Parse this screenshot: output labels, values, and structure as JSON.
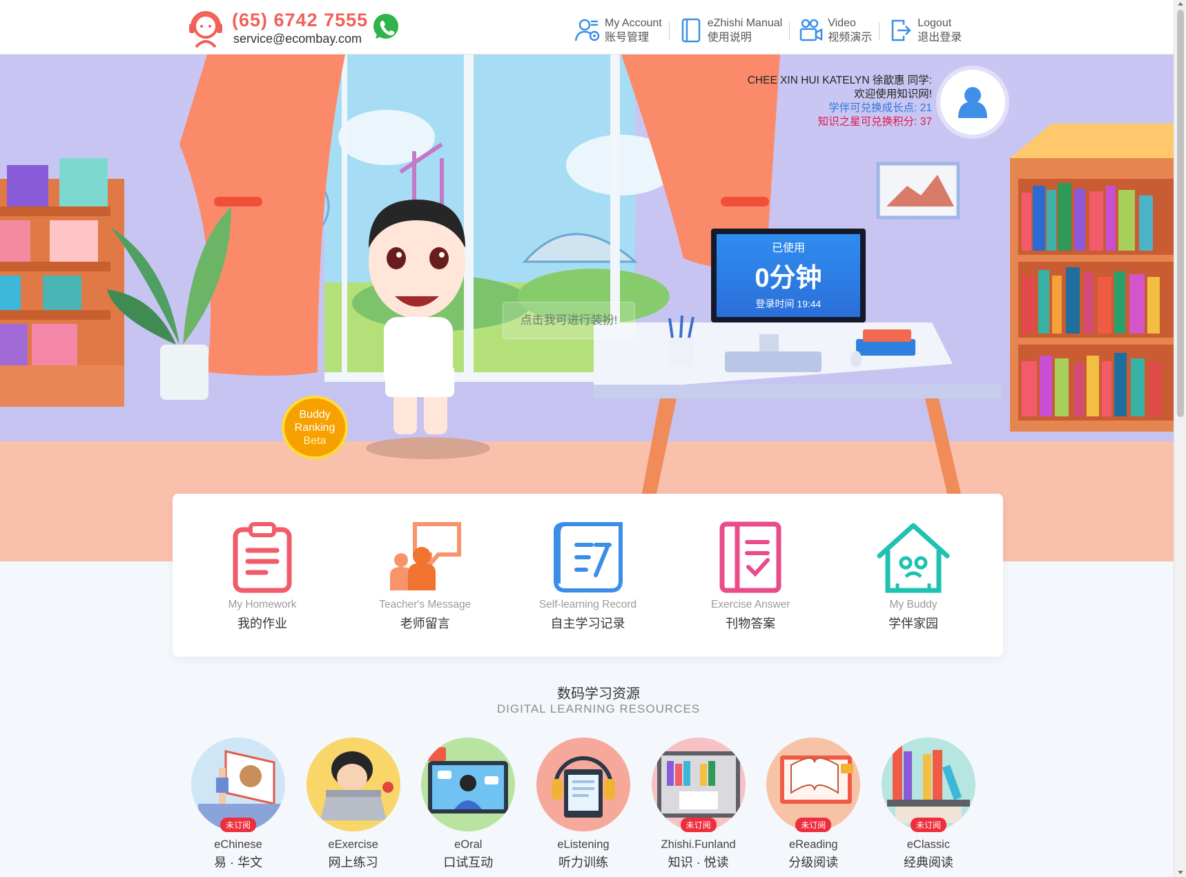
{
  "header": {
    "phone": "(65) 6742 7555",
    "email": "service@ecombay.com",
    "nav": [
      {
        "en": "My Account",
        "zh": "账号管理",
        "icon": "account-settings-icon"
      },
      {
        "en": "eZhishi Manual",
        "zh": "使用说明",
        "icon": "manual-icon"
      },
      {
        "en": "Video",
        "zh": "视频演示",
        "icon": "video-icon"
      },
      {
        "en": "Logout",
        "zh": "退出登录",
        "icon": "logout-icon"
      }
    ]
  },
  "user": {
    "name": "CHEE XIN HUI KATELYN 徐歆惠 同学:",
    "welcome": "欢迎使用知识网!",
    "growth_points": "学伴可兑换成长点: 21",
    "star_points": "知识之星可兑换积分: 37"
  },
  "monitor": {
    "used_label": "已使用",
    "minutes": "0分钟",
    "login_time": "登录时间 19:44"
  },
  "scene": {
    "dressup_tip": "点击我可进行装扮!",
    "buddy_ranking": [
      "Buddy",
      "Ranking",
      "Beta"
    ]
  },
  "features": [
    {
      "en": "My Homework",
      "zh": "我的作业"
    },
    {
      "en": "Teacher's Message",
      "zh": "老师留言"
    },
    {
      "en": "Self-learning Record",
      "zh": "自主学习记录"
    },
    {
      "en": "Exercise Answer",
      "zh": "刊物答案"
    },
    {
      "en": "My Buddy",
      "zh": "学伴家园"
    }
  ],
  "resources_section": {
    "title": "数码学习资源",
    "subtitle": "DIGITAL LEARNING RESOURCES"
  },
  "resources": [
    {
      "en": "eChinese",
      "zh": "易 · 华文",
      "badge": "未订阅"
    },
    {
      "en": "eExercise",
      "zh": "网上练习",
      "badge": ""
    },
    {
      "en": "eOral",
      "zh": "口试互动",
      "badge": ""
    },
    {
      "en": "eListening",
      "zh": "听力训练",
      "badge": ""
    },
    {
      "en": "Zhishi.Funland",
      "zh": "知识 · 悦读",
      "badge": "未订阅"
    },
    {
      "en": "eReading",
      "zh": "分级阅读",
      "badge": "未订阅"
    },
    {
      "en": "eClassic",
      "zh": "经典阅读",
      "badge": "未订阅"
    }
  ],
  "colors": {
    "brand_red": "#f0615a",
    "points_blue": "#2f79d9",
    "stars_red": "#e3184c",
    "badge_red": "#ee2d3d"
  }
}
